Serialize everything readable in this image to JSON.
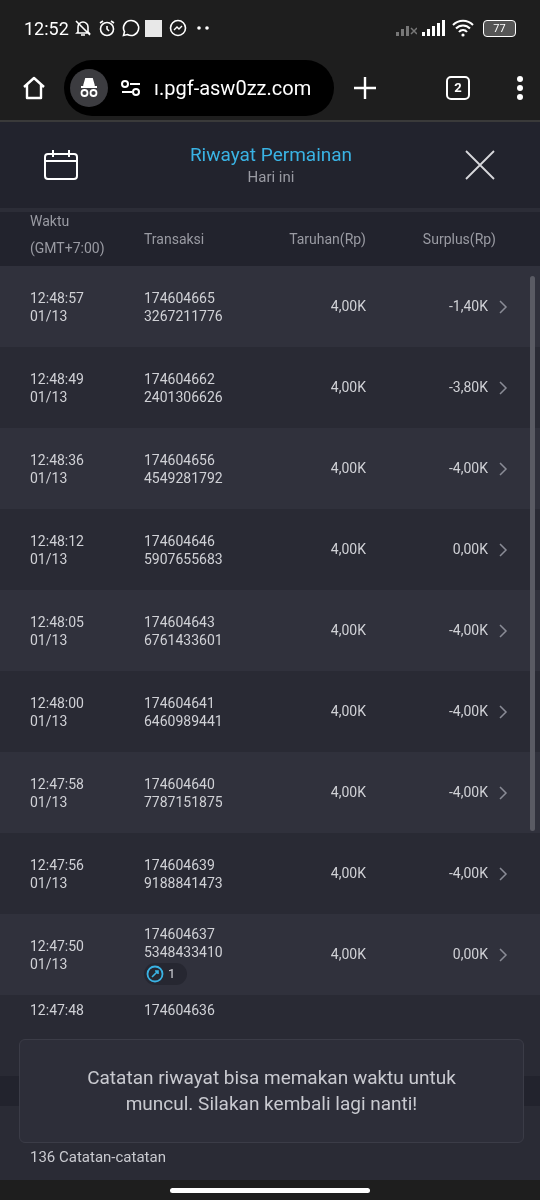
{
  "status_bar": {
    "time": "12:52",
    "battery": "77"
  },
  "browser": {
    "url": "ı.pgf-asw0zz.com",
    "tab_count": "2"
  },
  "header": {
    "title": "Riwayat Permainan",
    "subtitle": "Hari ini"
  },
  "table": {
    "columns": [
      {
        "label": "Waktu",
        "sub": "(GMT+7:00)"
      },
      {
        "label": "Transaksi"
      },
      {
        "label": "Taruhan(Rp)"
      },
      {
        "label": "Surplus(Rp)"
      }
    ],
    "rows": [
      {
        "time": "12:48:57",
        "date": "01/13",
        "tx1": "174604665",
        "tx2": "3267211776",
        "bet": "4,00K",
        "surplus": "-1,40K"
      },
      {
        "time": "12:48:49",
        "date": "01/13",
        "tx1": "174604662",
        "tx2": "2401306626",
        "bet": "4,00K",
        "surplus": "-3,80K"
      },
      {
        "time": "12:48:36",
        "date": "01/13",
        "tx1": "174604656",
        "tx2": "4549281792",
        "bet": "4,00K",
        "surplus": "-4,00K"
      },
      {
        "time": "12:48:12",
        "date": "01/13",
        "tx1": "174604646",
        "tx2": "5907655683",
        "bet": "4,00K",
        "surplus": "0,00K"
      },
      {
        "time": "12:48:05",
        "date": "01/13",
        "tx1": "174604643",
        "tx2": "6761433601",
        "bet": "4,00K",
        "surplus": "-4,00K"
      },
      {
        "time": "12:48:00",
        "date": "01/13",
        "tx1": "174604641",
        "tx2": "6460989441",
        "bet": "4,00K",
        "surplus": "-4,00K"
      },
      {
        "time": "12:47:58",
        "date": "01/13",
        "tx1": "174604640",
        "tx2": "7787151875",
        "bet": "4,00K",
        "surplus": "-4,00K"
      },
      {
        "time": "12:47:56",
        "date": "01/13",
        "tx1": "174604639",
        "tx2": "9188841473",
        "bet": "4,00K",
        "surplus": "-4,00K"
      },
      {
        "time": "12:47:50",
        "date": "01/13",
        "tx1": "174604637",
        "tx2": "5348433410",
        "badge": "1",
        "bet": "4,00K",
        "surplus": "0,00K"
      },
      {
        "time": "12:47:48",
        "tx1": "174604636"
      }
    ]
  },
  "footer": {
    "count": "136 Catatan-catatan"
  },
  "toast": {
    "message": "Catatan riwayat bisa memakan waktu untuk muncul. Silakan kembali lagi nanti!"
  }
}
